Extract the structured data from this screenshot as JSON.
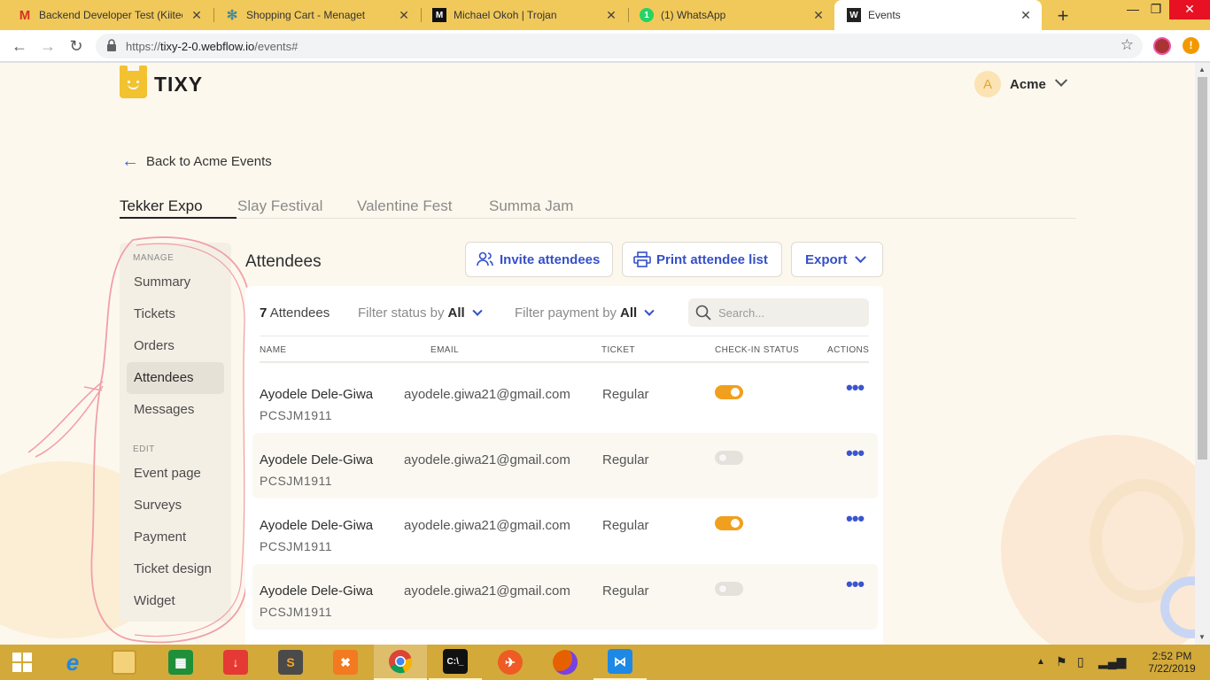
{
  "browser": {
    "tabs": [
      {
        "title": "Backend Developer Test (Kiitec)",
        "icon": "gmail-icon",
        "active": false
      },
      {
        "title": "Shopping Cart - Menaget",
        "icon": "gear-favicon-icon",
        "active": false
      },
      {
        "title": "Michael Okoh | Trojan",
        "icon": "medium-icon",
        "active": false
      },
      {
        "title": "(1) WhatsApp",
        "icon": "whatsapp-icon",
        "active": false,
        "badge": "1"
      },
      {
        "title": "Events",
        "icon": "webflow-icon",
        "active": true
      }
    ],
    "url": "https://tixy-2-0.webflow.io/events#",
    "url_host": "tixy-2-0.webflow.io",
    "url_prefix": "https://",
    "url_path": "/events#"
  },
  "app": {
    "logo_text": "TIXY",
    "account": {
      "initial": "A",
      "name": "Acme"
    },
    "back_link": "Back to Acme Events",
    "event_tabs": [
      "Tekker Expo",
      "Slay Festival",
      "Valentine Fest",
      "Summa Jam"
    ]
  },
  "sidebar": {
    "manage_heading": "MANAGE",
    "manage_items": [
      "Summary",
      "Tickets",
      "Orders",
      "Attendees",
      "Messages"
    ],
    "active_item": "Attendees",
    "edit_heading": "EDIT",
    "edit_items": [
      "Event page",
      "Surveys",
      "Payment",
      "Ticket design",
      "Widget"
    ]
  },
  "attendees": {
    "title": "Attendees",
    "invite_label": "Invite attendees",
    "print_label": "Print attendee list",
    "export_label": "Export",
    "count_number": "7",
    "count_label": "Attendees",
    "filter_status_label": "Filter status by",
    "filter_status_value": "All",
    "filter_payment_label": "Filter payment by",
    "filter_payment_value": "All",
    "search_placeholder": "Search...",
    "columns": [
      "NAME",
      "EMAIL",
      "TICKET",
      "CHECK-IN STATUS",
      "ACTIONS"
    ],
    "rows": [
      {
        "name": "Ayodele Dele-Giwa",
        "code": "PCSJM1911",
        "email": "ayodele.giwa21@gmail.com",
        "ticket": "Regular",
        "checked_in": true
      },
      {
        "name": "Ayodele Dele-Giwa",
        "code": "PCSJM1911",
        "email": "ayodele.giwa21@gmail.com",
        "ticket": "Regular",
        "checked_in": false
      },
      {
        "name": "Ayodele Dele-Giwa",
        "code": "PCSJM1911",
        "email": "ayodele.giwa21@gmail.com",
        "ticket": "Regular",
        "checked_in": true
      },
      {
        "name": "Ayodele Dele-Giwa",
        "code": "PCSJM1911",
        "email": "ayodele.giwa21@gmail.com",
        "ticket": "Regular",
        "checked_in": false
      }
    ],
    "actions_glyph": "•••"
  },
  "taskbar": {
    "time": "2:52 PM",
    "date": "7/22/2019"
  },
  "colors": {
    "accent": "#3550c8",
    "brand": "#f2c230",
    "toggle_on": "#f0a01e",
    "tab_strip": "#f1c95a",
    "taskbar": "#d3a93a"
  }
}
